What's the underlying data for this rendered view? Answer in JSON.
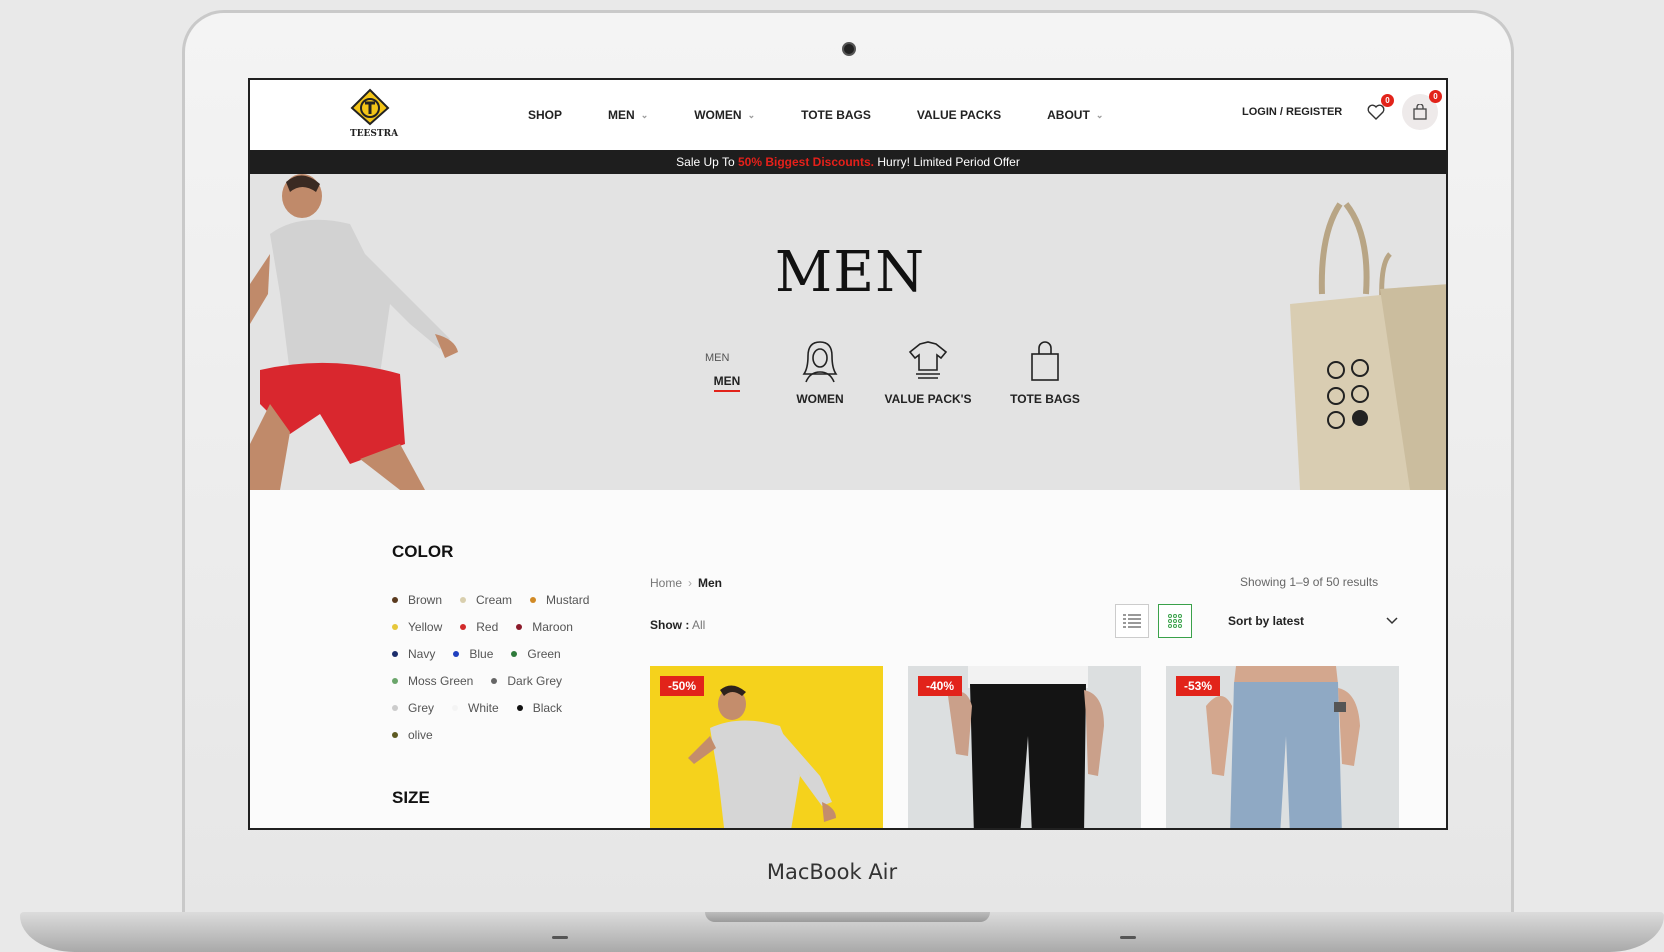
{
  "device": {
    "label": "MacBook Air"
  },
  "nav": {
    "logo_text": "TEESTRA",
    "menu": [
      {
        "label": "SHOP",
        "dropdown": false
      },
      {
        "label": "MEN",
        "dropdown": true
      },
      {
        "label": "WOMEN",
        "dropdown": true
      },
      {
        "label": "TOTE BAGS",
        "dropdown": false
      },
      {
        "label": "VALUE PACKS",
        "dropdown": false
      },
      {
        "label": "ABOUT",
        "dropdown": true
      }
    ],
    "login_label": "LOGIN / REGISTER",
    "wishlist_count": "0",
    "cart_count": "0"
  },
  "promo": {
    "prefix": "Sale Up To ",
    "highlight": "50% Biggest Discounts.",
    "suffix": " Hurry! Limited Period Offer"
  },
  "hero": {
    "title": "MEN",
    "categories": [
      {
        "label": "MEN",
        "broken_image_alt": "MEN",
        "icon": "broken-image-icon",
        "active": true
      },
      {
        "label": "WOMEN",
        "icon": "woman-icon"
      },
      {
        "label": "VALUE PACK'S",
        "icon": "tshirt-stack-icon"
      },
      {
        "label": "TOTE BAGS",
        "icon": "tote-bag-icon"
      }
    ]
  },
  "filters": {
    "color_title": "COLOR",
    "size_title": "SIZE",
    "colors": [
      [
        {
          "name": "Brown",
          "hex": "#5a3a1e"
        },
        {
          "name": "Cream",
          "hex": "#d9cfae"
        },
        {
          "name": "Mustard",
          "hex": "#d18a25"
        }
      ],
      [
        {
          "name": "Yellow",
          "hex": "#e6c73a"
        },
        {
          "name": "Red",
          "hex": "#d22a2a"
        },
        {
          "name": "Maroon",
          "hex": "#8b1a2a"
        }
      ],
      [
        {
          "name": "Navy",
          "hex": "#1c2d6b"
        },
        {
          "name": "Blue",
          "hex": "#1f3fbf"
        },
        {
          "name": "Green",
          "hex": "#2e7a3a"
        }
      ],
      [
        {
          "name": "Moss Green",
          "hex": "#6aa56a"
        },
        {
          "name": "Dark Grey",
          "hex": "#666666"
        }
      ],
      [
        {
          "name": "Grey",
          "hex": "#cccccc"
        },
        {
          "name": "White",
          "hex": "#f4f4f4"
        },
        {
          "name": "Black",
          "hex": "#111111"
        }
      ],
      [
        {
          "name": "olive",
          "hex": "#5d5a22"
        }
      ]
    ]
  },
  "listing": {
    "breadcrumb_home": "Home",
    "breadcrumb_current": "Men",
    "results_text": "Showing 1–9 of 50 results",
    "show_label": "Show :",
    "show_value": "All",
    "sort_label": "Sort by latest",
    "products": [
      {
        "discount": "-50%"
      },
      {
        "discount": "-40%"
      },
      {
        "discount": "-53%"
      }
    ]
  },
  "colors": {
    "accent": "#e2231a",
    "grid_active": "#3aa14a",
    "promo_bg": "#1e1e1e"
  }
}
